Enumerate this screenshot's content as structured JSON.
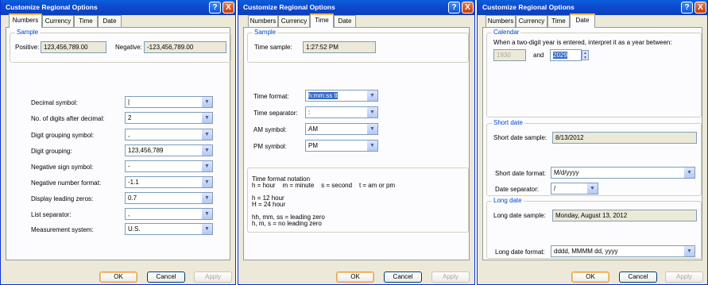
{
  "title": "Customize Regional Options",
  "title_buttons": {
    "help": "?",
    "close": "X"
  },
  "tabs": [
    "Numbers",
    "Currency",
    "Time",
    "Date"
  ],
  "buttons": {
    "ok": "OK",
    "cancel": "Cancel",
    "apply": "Apply"
  },
  "numbers": {
    "sample_label": "Sample",
    "positive_label": "Positive:",
    "positive_value": "123,456,789.00",
    "negative_label": "Negative:",
    "negative_value": "-123,456,789.00",
    "rows": [
      {
        "label": "Decimal symbol:",
        "value": "|"
      },
      {
        "label": "No. of digits after decimal:",
        "value": "2"
      },
      {
        "label": "Digit grouping symbol:",
        "value": ","
      },
      {
        "label": "Digit grouping:",
        "value": "123,456,789"
      },
      {
        "label": "Negative sign symbol:",
        "value": "-"
      },
      {
        "label": "Negative number format:",
        "value": "-1.1"
      },
      {
        "label": "Display leading zeros:",
        "value": "0.7"
      },
      {
        "label": "List separator:",
        "value": ","
      },
      {
        "label": "Measurement system:",
        "value": "U.S."
      }
    ]
  },
  "time": {
    "sample_label": "Sample",
    "time_sample_label": "Time sample:",
    "time_sample_value": "1:27:52 PM",
    "rows": [
      {
        "label": "Time format:",
        "value": "h:mm:ss tt"
      },
      {
        "label": "Time separator:",
        "value": ":"
      },
      {
        "label": "AM symbol:",
        "value": "AM"
      },
      {
        "label": "PM symbol:",
        "value": "PM"
      }
    ],
    "notation": {
      "heading": "Time format notation",
      "line1": "h = hour    m = minute    s = second    t = am or pm",
      "line2": "h = 12 hour",
      "line3": "H = 24 hour",
      "line4": "hh, mm, ss = leading zero",
      "line5": "h, m, s = no leading zero"
    }
  },
  "date": {
    "calendar_label": "Calendar",
    "two_digit_text": "When a two-digit year is entered, interpret it as a year between:",
    "year_from": "1930",
    "and_label": "and",
    "year_to": "2029",
    "short_group_label": "Short date",
    "short_sample_label": "Short date sample:",
    "short_sample_value": "8/13/2012",
    "short_format_label": "Short date format:",
    "short_format_value": "M/d/yyyy",
    "separator_label": "Date separator:",
    "separator_value": "/",
    "long_group_label": "Long date",
    "long_sample_label": "Long date sample:",
    "long_sample_value": "Monday, August 13, 2012",
    "long_format_label": "Long date format:",
    "long_format_value": "dddd, MMMM dd, yyyy"
  }
}
